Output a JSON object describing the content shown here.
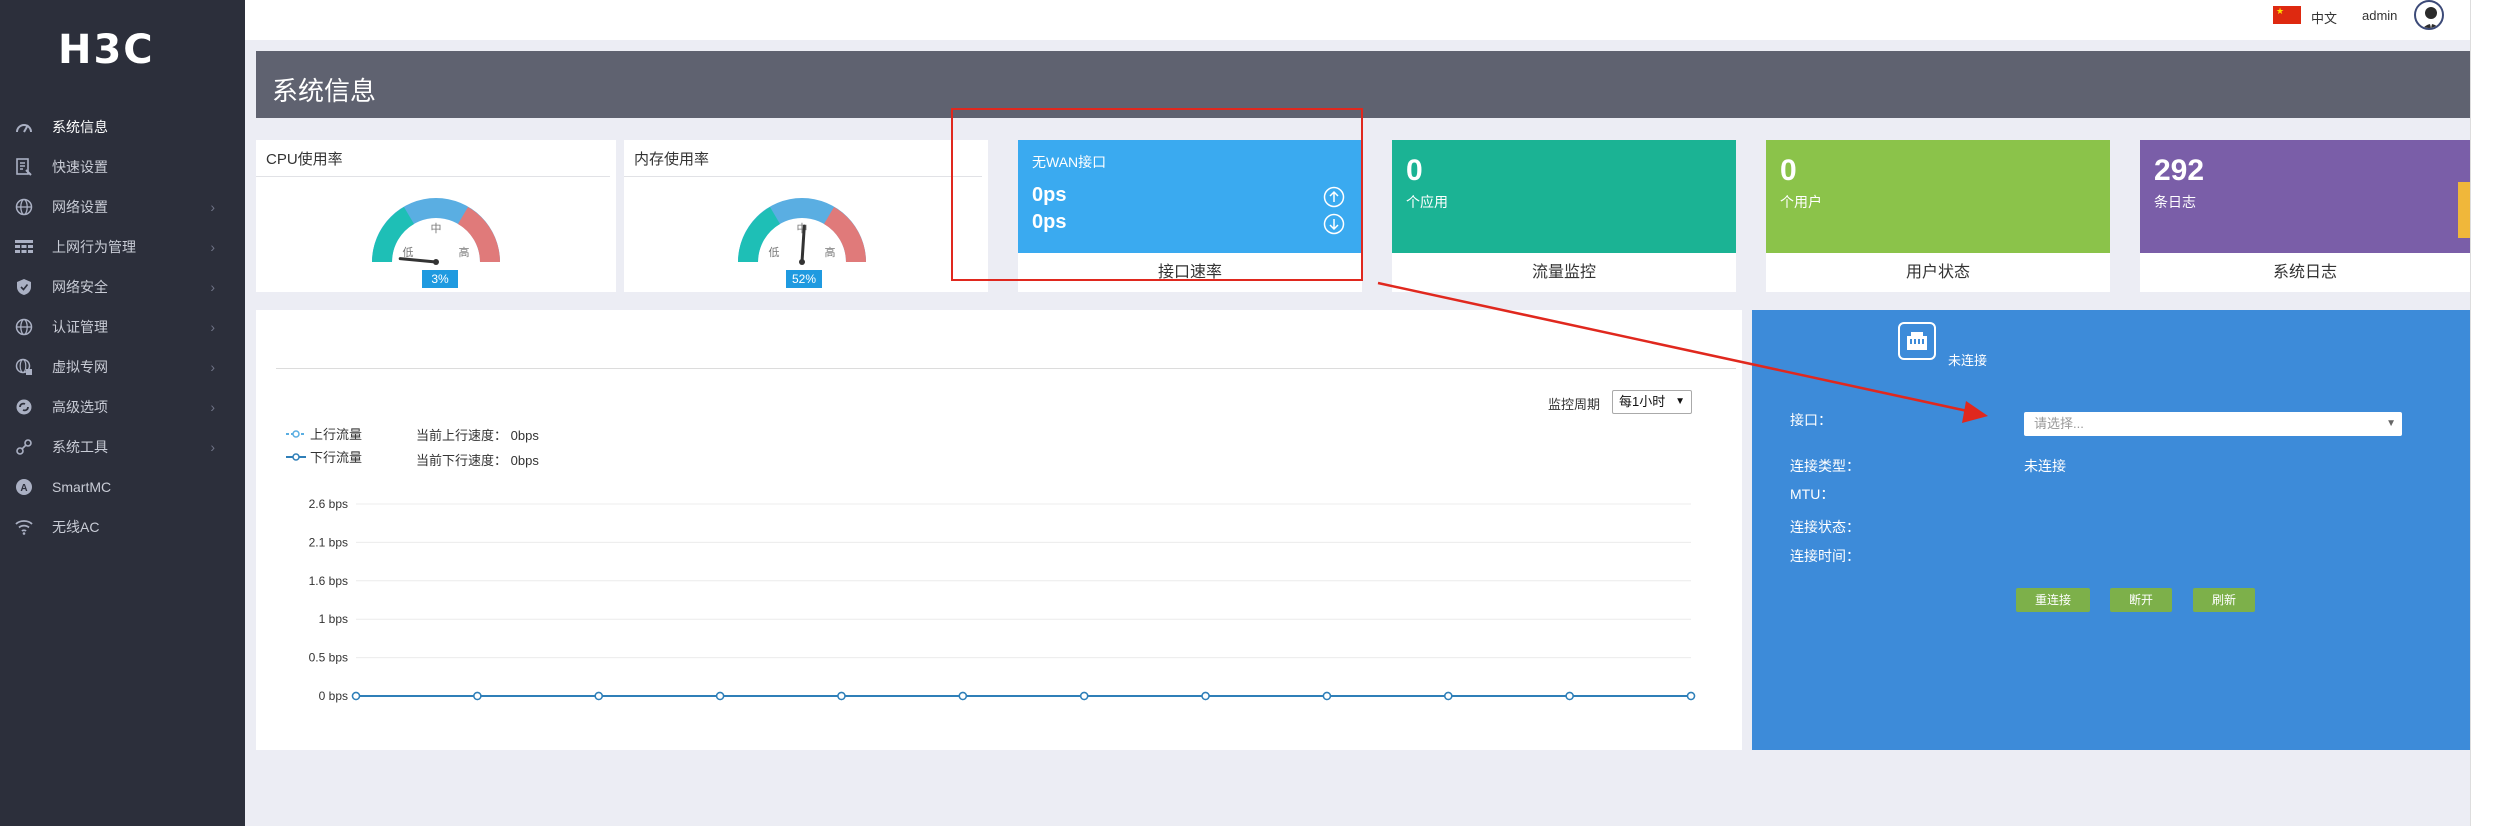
{
  "brand": {
    "logo": "H3C"
  },
  "sidebar": {
    "items": [
      {
        "label": "系统信息",
        "icon": "dashboard-icon",
        "has_arrow": false,
        "active": true
      },
      {
        "label": "快速设置",
        "icon": "quick-setup-icon",
        "has_arrow": false
      },
      {
        "label": "网络设置",
        "icon": "globe-icon",
        "has_arrow": true
      },
      {
        "label": "上网行为管理",
        "icon": "grid-icon",
        "has_arrow": true
      },
      {
        "label": "网络安全",
        "icon": "shield-icon",
        "has_arrow": true
      },
      {
        "label": "认证管理",
        "icon": "globe-icon",
        "has_arrow": true
      },
      {
        "label": "虚拟专网",
        "icon": "globe-lock-icon",
        "has_arrow": true
      },
      {
        "label": "高级选项",
        "icon": "gears-icon",
        "has_arrow": true
      },
      {
        "label": "系统工具",
        "icon": "tools-icon",
        "has_arrow": true
      },
      {
        "label": "SmartMC",
        "icon": "smartmc-icon",
        "has_arrow": false
      },
      {
        "label": "无线AC",
        "icon": "wifi-icon",
        "has_arrow": false
      }
    ],
    "arrow_glyph": "›"
  },
  "topbar": {
    "language": "中文",
    "user": "admin",
    "flag": "china-flag-icon"
  },
  "page": {
    "title": "系统信息"
  },
  "gauges": {
    "cpu": {
      "title": "CPU使用率",
      "value_label": "3%",
      "value": 3,
      "mid": "中",
      "low": "低",
      "high": "高"
    },
    "mem": {
      "title": "内存使用率",
      "value_label": "52%",
      "value": 52,
      "mid": "中",
      "low": "低",
      "high": "高"
    }
  },
  "tiles": {
    "wan": {
      "title": "无WAN接口",
      "up": "0ps",
      "down": "0ps",
      "footer": "接口速率",
      "color": "#3aaaf0"
    },
    "apps": {
      "value": "0",
      "label": "个应用",
      "footer": "流量监控",
      "color": "#1bb394"
    },
    "users": {
      "value": "0",
      "label": "个用户",
      "footer": "用户状态",
      "color": "#8bc34a"
    },
    "logs": {
      "value": "292",
      "label": "条日志",
      "footer": "系统日志",
      "color": "#7a5ea8"
    }
  },
  "traffic": {
    "legend_up": "上行流量",
    "legend_down": "下行流量",
    "cur_up_label": "当前上行速度：",
    "cur_up_value": "0bps",
    "cur_down_label": "当前下行速度：",
    "cur_down_value": "0bps",
    "period_label": "监控周期",
    "period_value": "每1小时"
  },
  "chart_data": {
    "type": "line",
    "title": "",
    "xlabel": "",
    "ylabel": "",
    "yticks": [
      "2.6 bps",
      "2.1 bps",
      "1.6 bps",
      "1 bps",
      "0.5 bps",
      "0 bps"
    ],
    "ylim": [
      0,
      2.6
    ],
    "series": [
      {
        "name": "上行流量",
        "values": [
          0,
          0,
          0,
          0,
          0,
          0,
          0,
          0,
          0,
          0,
          0,
          0
        ]
      },
      {
        "name": "下行流量",
        "values": [
          0,
          0,
          0,
          0,
          0,
          0,
          0,
          0,
          0,
          0,
          0,
          0
        ]
      }
    ],
    "grid": true,
    "colors": {
      "up": "#5aaee2",
      "down": "#2f7fb8"
    }
  },
  "connection": {
    "status": "未连接",
    "interface_label": "接口：",
    "interface_placeholder": "请选择...",
    "type_label": "连接类型：",
    "type_value": "未连接",
    "mtu_label": "MTU：",
    "state_label": "连接状态：",
    "time_label": "连接时间：",
    "btn_reconnect": "重连接",
    "btn_disconnect": "断开",
    "btn_refresh": "刷新"
  }
}
